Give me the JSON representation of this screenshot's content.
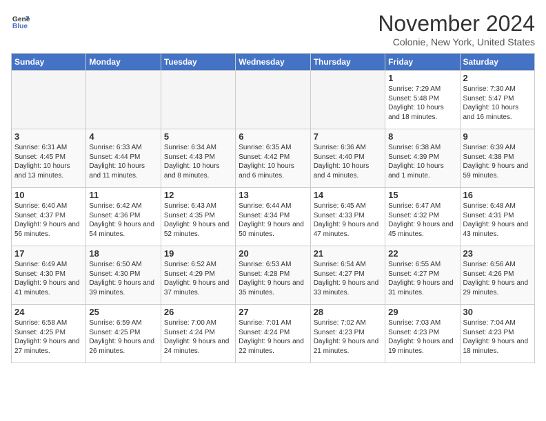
{
  "header": {
    "logo_line1": "General",
    "logo_line2": "Blue",
    "title": "November 2024",
    "subtitle": "Colonie, New York, United States"
  },
  "days_of_week": [
    "Sunday",
    "Monday",
    "Tuesday",
    "Wednesday",
    "Thursday",
    "Friday",
    "Saturday"
  ],
  "weeks": [
    [
      {
        "day": "",
        "sunrise": "",
        "sunset": "",
        "daylight": "",
        "empty": true
      },
      {
        "day": "",
        "sunrise": "",
        "sunset": "",
        "daylight": "",
        "empty": true
      },
      {
        "day": "",
        "sunrise": "",
        "sunset": "",
        "daylight": "",
        "empty": true
      },
      {
        "day": "",
        "sunrise": "",
        "sunset": "",
        "daylight": "",
        "empty": true
      },
      {
        "day": "",
        "sunrise": "",
        "sunset": "",
        "daylight": "",
        "empty": true
      },
      {
        "day": "1",
        "sunrise": "Sunrise: 7:29 AM",
        "sunset": "Sunset: 5:48 PM",
        "daylight": "Daylight: 10 hours and 18 minutes.",
        "empty": false
      },
      {
        "day": "2",
        "sunrise": "Sunrise: 7:30 AM",
        "sunset": "Sunset: 5:47 PM",
        "daylight": "Daylight: 10 hours and 16 minutes.",
        "empty": false
      }
    ],
    [
      {
        "day": "3",
        "sunrise": "Sunrise: 6:31 AM",
        "sunset": "Sunset: 4:45 PM",
        "daylight": "Daylight: 10 hours and 13 minutes.",
        "empty": false
      },
      {
        "day": "4",
        "sunrise": "Sunrise: 6:33 AM",
        "sunset": "Sunset: 4:44 PM",
        "daylight": "Daylight: 10 hours and 11 minutes.",
        "empty": false
      },
      {
        "day": "5",
        "sunrise": "Sunrise: 6:34 AM",
        "sunset": "Sunset: 4:43 PM",
        "daylight": "Daylight: 10 hours and 8 minutes.",
        "empty": false
      },
      {
        "day": "6",
        "sunrise": "Sunrise: 6:35 AM",
        "sunset": "Sunset: 4:42 PM",
        "daylight": "Daylight: 10 hours and 6 minutes.",
        "empty": false
      },
      {
        "day": "7",
        "sunrise": "Sunrise: 6:36 AM",
        "sunset": "Sunset: 4:40 PM",
        "daylight": "Daylight: 10 hours and 4 minutes.",
        "empty": false
      },
      {
        "day": "8",
        "sunrise": "Sunrise: 6:38 AM",
        "sunset": "Sunset: 4:39 PM",
        "daylight": "Daylight: 10 hours and 1 minute.",
        "empty": false
      },
      {
        "day": "9",
        "sunrise": "Sunrise: 6:39 AM",
        "sunset": "Sunset: 4:38 PM",
        "daylight": "Daylight: 9 hours and 59 minutes.",
        "empty": false
      }
    ],
    [
      {
        "day": "10",
        "sunrise": "Sunrise: 6:40 AM",
        "sunset": "Sunset: 4:37 PM",
        "daylight": "Daylight: 9 hours and 56 minutes.",
        "empty": false
      },
      {
        "day": "11",
        "sunrise": "Sunrise: 6:42 AM",
        "sunset": "Sunset: 4:36 PM",
        "daylight": "Daylight: 9 hours and 54 minutes.",
        "empty": false
      },
      {
        "day": "12",
        "sunrise": "Sunrise: 6:43 AM",
        "sunset": "Sunset: 4:35 PM",
        "daylight": "Daylight: 9 hours and 52 minutes.",
        "empty": false
      },
      {
        "day": "13",
        "sunrise": "Sunrise: 6:44 AM",
        "sunset": "Sunset: 4:34 PM",
        "daylight": "Daylight: 9 hours and 50 minutes.",
        "empty": false
      },
      {
        "day": "14",
        "sunrise": "Sunrise: 6:45 AM",
        "sunset": "Sunset: 4:33 PM",
        "daylight": "Daylight: 9 hours and 47 minutes.",
        "empty": false
      },
      {
        "day": "15",
        "sunrise": "Sunrise: 6:47 AM",
        "sunset": "Sunset: 4:32 PM",
        "daylight": "Daylight: 9 hours and 45 minutes.",
        "empty": false
      },
      {
        "day": "16",
        "sunrise": "Sunrise: 6:48 AM",
        "sunset": "Sunset: 4:31 PM",
        "daylight": "Daylight: 9 hours and 43 minutes.",
        "empty": false
      }
    ],
    [
      {
        "day": "17",
        "sunrise": "Sunrise: 6:49 AM",
        "sunset": "Sunset: 4:30 PM",
        "daylight": "Daylight: 9 hours and 41 minutes.",
        "empty": false
      },
      {
        "day": "18",
        "sunrise": "Sunrise: 6:50 AM",
        "sunset": "Sunset: 4:30 PM",
        "daylight": "Daylight: 9 hours and 39 minutes.",
        "empty": false
      },
      {
        "day": "19",
        "sunrise": "Sunrise: 6:52 AM",
        "sunset": "Sunset: 4:29 PM",
        "daylight": "Daylight: 9 hours and 37 minutes.",
        "empty": false
      },
      {
        "day": "20",
        "sunrise": "Sunrise: 6:53 AM",
        "sunset": "Sunset: 4:28 PM",
        "daylight": "Daylight: 9 hours and 35 minutes.",
        "empty": false
      },
      {
        "day": "21",
        "sunrise": "Sunrise: 6:54 AM",
        "sunset": "Sunset: 4:27 PM",
        "daylight": "Daylight: 9 hours and 33 minutes.",
        "empty": false
      },
      {
        "day": "22",
        "sunrise": "Sunrise: 6:55 AM",
        "sunset": "Sunset: 4:27 PM",
        "daylight": "Daylight: 9 hours and 31 minutes.",
        "empty": false
      },
      {
        "day": "23",
        "sunrise": "Sunrise: 6:56 AM",
        "sunset": "Sunset: 4:26 PM",
        "daylight": "Daylight: 9 hours and 29 minutes.",
        "empty": false
      }
    ],
    [
      {
        "day": "24",
        "sunrise": "Sunrise: 6:58 AM",
        "sunset": "Sunset: 4:25 PM",
        "daylight": "Daylight: 9 hours and 27 minutes.",
        "empty": false
      },
      {
        "day": "25",
        "sunrise": "Sunrise: 6:59 AM",
        "sunset": "Sunset: 4:25 PM",
        "daylight": "Daylight: 9 hours and 26 minutes.",
        "empty": false
      },
      {
        "day": "26",
        "sunrise": "Sunrise: 7:00 AM",
        "sunset": "Sunset: 4:24 PM",
        "daylight": "Daylight: 9 hours and 24 minutes.",
        "empty": false
      },
      {
        "day": "27",
        "sunrise": "Sunrise: 7:01 AM",
        "sunset": "Sunset: 4:24 PM",
        "daylight": "Daylight: 9 hours and 22 minutes.",
        "empty": false
      },
      {
        "day": "28",
        "sunrise": "Sunrise: 7:02 AM",
        "sunset": "Sunset: 4:23 PM",
        "daylight": "Daylight: 9 hours and 21 minutes.",
        "empty": false
      },
      {
        "day": "29",
        "sunrise": "Sunrise: 7:03 AM",
        "sunset": "Sunset: 4:23 PM",
        "daylight": "Daylight: 9 hours and 19 minutes.",
        "empty": false
      },
      {
        "day": "30",
        "sunrise": "Sunrise: 7:04 AM",
        "sunset": "Sunset: 4:23 PM",
        "daylight": "Daylight: 9 hours and 18 minutes.",
        "empty": false
      }
    ]
  ]
}
